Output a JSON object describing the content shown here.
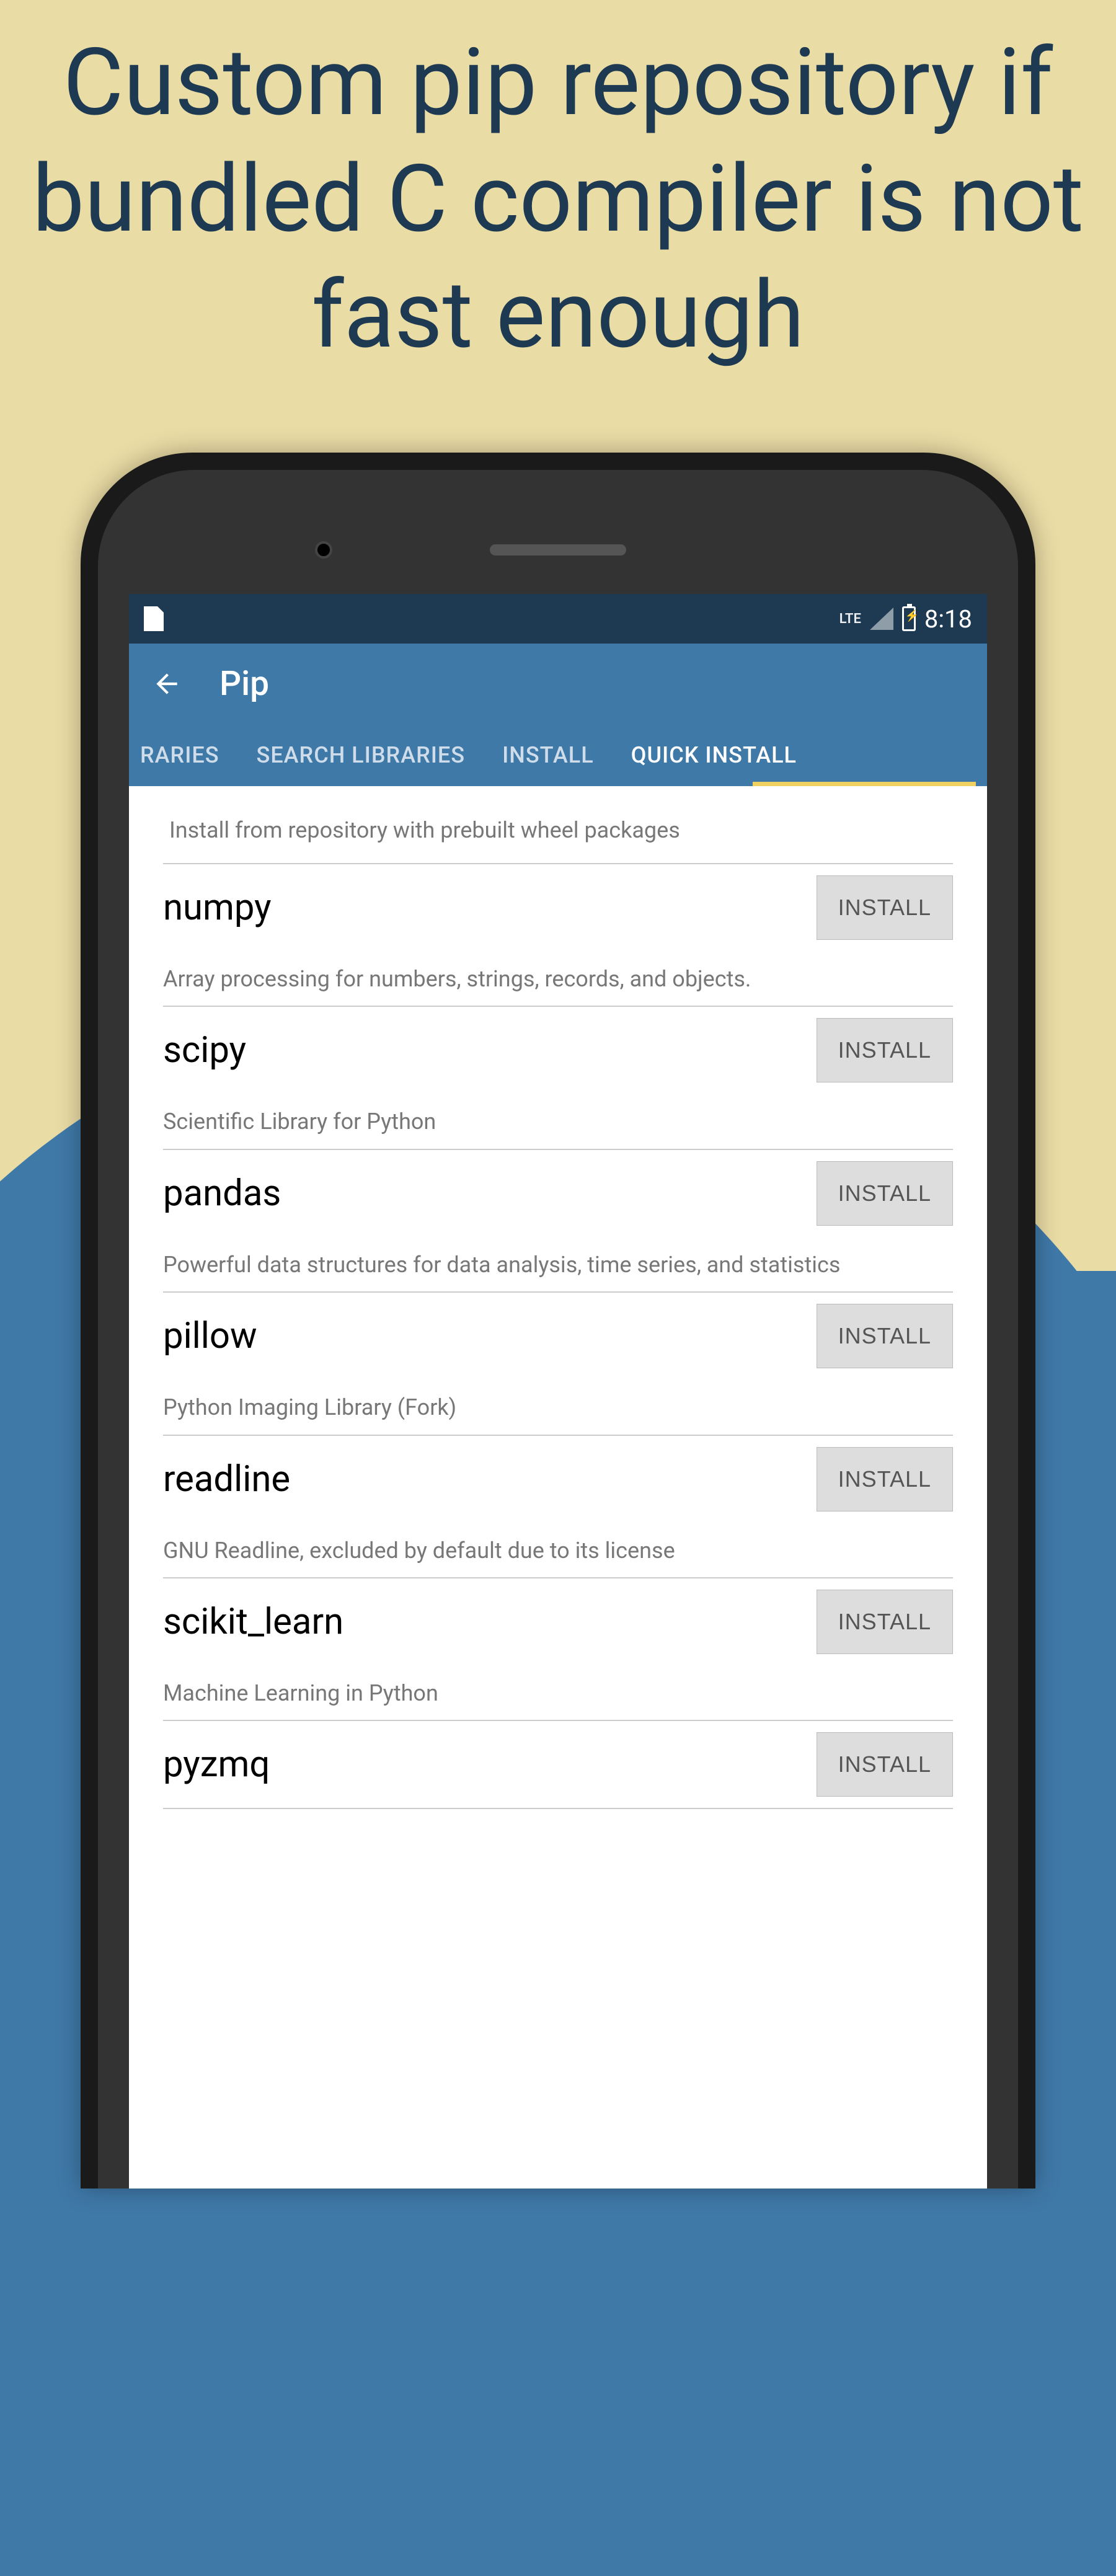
{
  "marketing": {
    "headline": "Custom pip repository if bundled C compiler is not fast enough"
  },
  "status_bar": {
    "lte_label": "LTE",
    "time": "8:18"
  },
  "app_bar": {
    "title": "Pip"
  },
  "tabs": {
    "items": [
      {
        "label": "RARIES"
      },
      {
        "label": "SEARCH LIBRARIES"
      },
      {
        "label": "INSTALL"
      },
      {
        "label": "QUICK INSTALL"
      }
    ]
  },
  "section": {
    "header": "Install from repository with prebuilt wheel packages"
  },
  "install_button_label": "INSTALL",
  "packages": [
    {
      "name": "numpy",
      "desc": "Array processing for numbers, strings, records, and objects."
    },
    {
      "name": "scipy",
      "desc": "Scientific Library for Python"
    },
    {
      "name": "pandas",
      "desc": "Powerful data structures for data analysis, time series, and statistics"
    },
    {
      "name": "pillow",
      "desc": "Python Imaging Library (Fork)"
    },
    {
      "name": "readline",
      "desc": "GNU Readline, excluded by default due to its license"
    },
    {
      "name": "scikit_learn",
      "desc": "Machine Learning in Python"
    },
    {
      "name": "pyzmq",
      "desc": ""
    }
  ]
}
